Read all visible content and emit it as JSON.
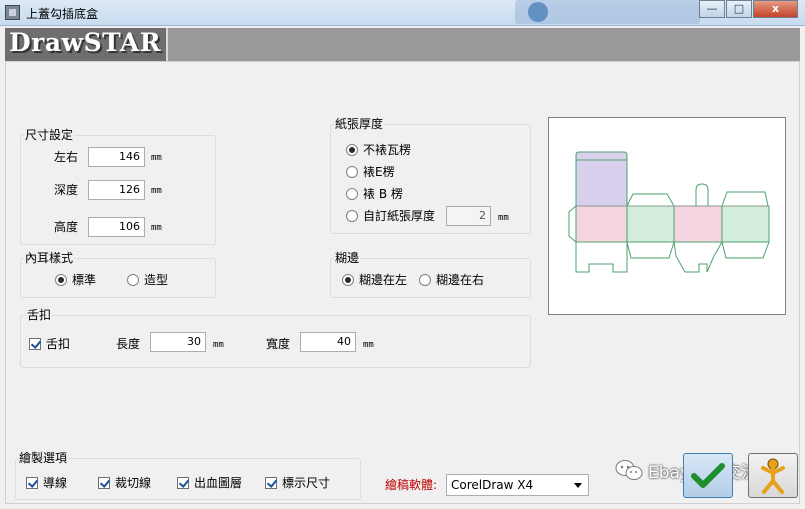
{
  "window": {
    "title": "上蓋勾插底盒",
    "controls": {
      "minimize": "—",
      "maximize": "□",
      "close": "x"
    }
  },
  "banner": {
    "logo": "DrawSTAR"
  },
  "dimensions": {
    "group_label": "尺寸設定",
    "width_label": "左右",
    "width_value": "146",
    "depth_label": "深度",
    "depth_value": "126",
    "height_label": "高度",
    "height_value": "106",
    "unit": "mm"
  },
  "inner_ear": {
    "group_label": "內耳樣式",
    "options": [
      {
        "label": "標準",
        "selected": true
      },
      {
        "label": "造型",
        "selected": false
      }
    ]
  },
  "paper": {
    "group_label": "紙張厚度",
    "options": [
      {
        "label": "不裱瓦楞",
        "selected": true
      },
      {
        "label": "裱E楞",
        "selected": false
      },
      {
        "label": "裱 B 楞",
        "selected": false
      },
      {
        "label": "自訂紙張厚度",
        "selected": false
      }
    ],
    "custom_value": "2",
    "unit": "mm"
  },
  "glue": {
    "group_label": "糊邊",
    "options": [
      {
        "label": "糊邊在左",
        "selected": true
      },
      {
        "label": "糊邊在右",
        "selected": false
      }
    ]
  },
  "tongue": {
    "group_label": "舌扣",
    "checkbox_label": "舌扣",
    "checked": true,
    "length_label": "長度",
    "length_value": "30",
    "width_label": "寬度",
    "width_value": "40",
    "unit": "mm"
  },
  "draw_options": {
    "group_label": "繪製選項",
    "items": [
      {
        "label": "導線",
        "checked": true
      },
      {
        "label": "裁切線",
        "checked": true
      },
      {
        "label": "出血圖層",
        "checked": true
      },
      {
        "label": "標示尺寸",
        "checked": true
      }
    ]
  },
  "software": {
    "label": "繪稿軟體:",
    "value": "CorelDraw X4",
    "label_color": "#c00000"
  },
  "watermark": {
    "text": "Ebay賣家交流"
  },
  "icons": [
    "app-icon",
    "check-icon",
    "exit-icon",
    "dropdown-arrow-icon",
    "wechat-icon"
  ]
}
